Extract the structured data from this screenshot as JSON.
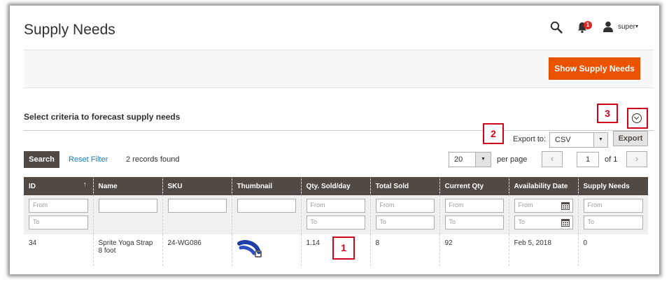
{
  "header": {
    "title": "Supply Needs",
    "notifications_count": "1",
    "username": "super",
    "caret": "▾"
  },
  "actions": {
    "show_supply_needs": "Show Supply Needs"
  },
  "section": {
    "title": "Select criteria to forecast supply needs"
  },
  "callouts": {
    "c1": "1",
    "c2": "2",
    "c3": "3"
  },
  "export": {
    "label": "Export to:",
    "format": "CSV",
    "button": "Export"
  },
  "toolbar": {
    "search": "Search",
    "reset": "Reset Filter",
    "records": "2 records found",
    "per_page_value": "20",
    "per_page_label": "per page",
    "page_value": "1",
    "page_of": "of 1",
    "prev": "‹",
    "next": "›"
  },
  "grid": {
    "columns": [
      "ID",
      "Name",
      "SKU",
      "Thumbnail",
      "Qty. Sold/day",
      "Total Sold",
      "Current Qty",
      "Availability Date",
      "Supply Needs"
    ],
    "sort_indicator": "↑",
    "filter": {
      "from": "From",
      "to": "To"
    },
    "rows": [
      {
        "id": "34",
        "name": "Sprite Yoga Strap 8 foot",
        "sku": "24-WG086",
        "qty_sold_day": "1.14",
        "total_sold": "8",
        "current_qty": "92",
        "availability_date": "Feb 5, 2018",
        "supply_needs": "0"
      }
    ]
  },
  "colors": {
    "accent": "#eb5202",
    "grid_header": "#514943",
    "callout": "#d0021b",
    "link": "#1979c3"
  }
}
